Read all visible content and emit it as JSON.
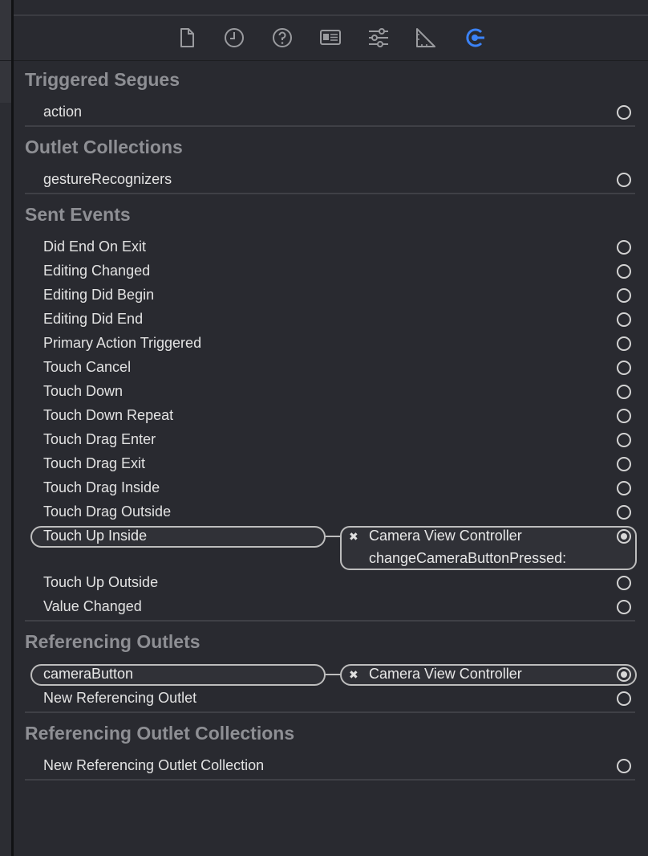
{
  "toolbar": {
    "icons": [
      "file-icon",
      "history-icon",
      "help-icon",
      "identity-icon",
      "attributes-icon",
      "size-ruler-icon",
      "connections-icon"
    ],
    "active": "connections-icon",
    "accent": "#3b82f6"
  },
  "sections": {
    "triggered_segues": {
      "title": "Triggered Segues",
      "items": [
        "action"
      ]
    },
    "outlet_collections": {
      "title": "Outlet Collections",
      "items": [
        "gestureRecognizers"
      ]
    },
    "sent_events": {
      "title": "Sent Events",
      "items": [
        "Did End On Exit",
        "Editing Changed",
        "Editing Did Begin",
        "Editing Did End",
        "Primary Action Triggered",
        "Touch Cancel",
        "Touch Down",
        "Touch Down Repeat",
        "Touch Drag Enter",
        "Touch Drag Exit",
        "Touch Drag Inside",
        "Touch Drag Outside"
      ],
      "connected_event": {
        "label": "Touch Up Inside",
        "target": "Camera View Controller",
        "action": "changeCameraButtonPressed:",
        "remove_glyph": "✖"
      },
      "after_items": [
        "Touch Up Outside",
        "Value Changed"
      ]
    },
    "referencing_outlets": {
      "title": "Referencing Outlets",
      "connected_outlet": {
        "label": "cameraButton",
        "target": "Camera View Controller",
        "remove_glyph": "✖"
      },
      "items": [
        "New Referencing Outlet"
      ]
    },
    "referencing_outlet_collections": {
      "title": "Referencing Outlet Collections",
      "items": [
        "New Referencing Outlet Collection"
      ]
    }
  }
}
